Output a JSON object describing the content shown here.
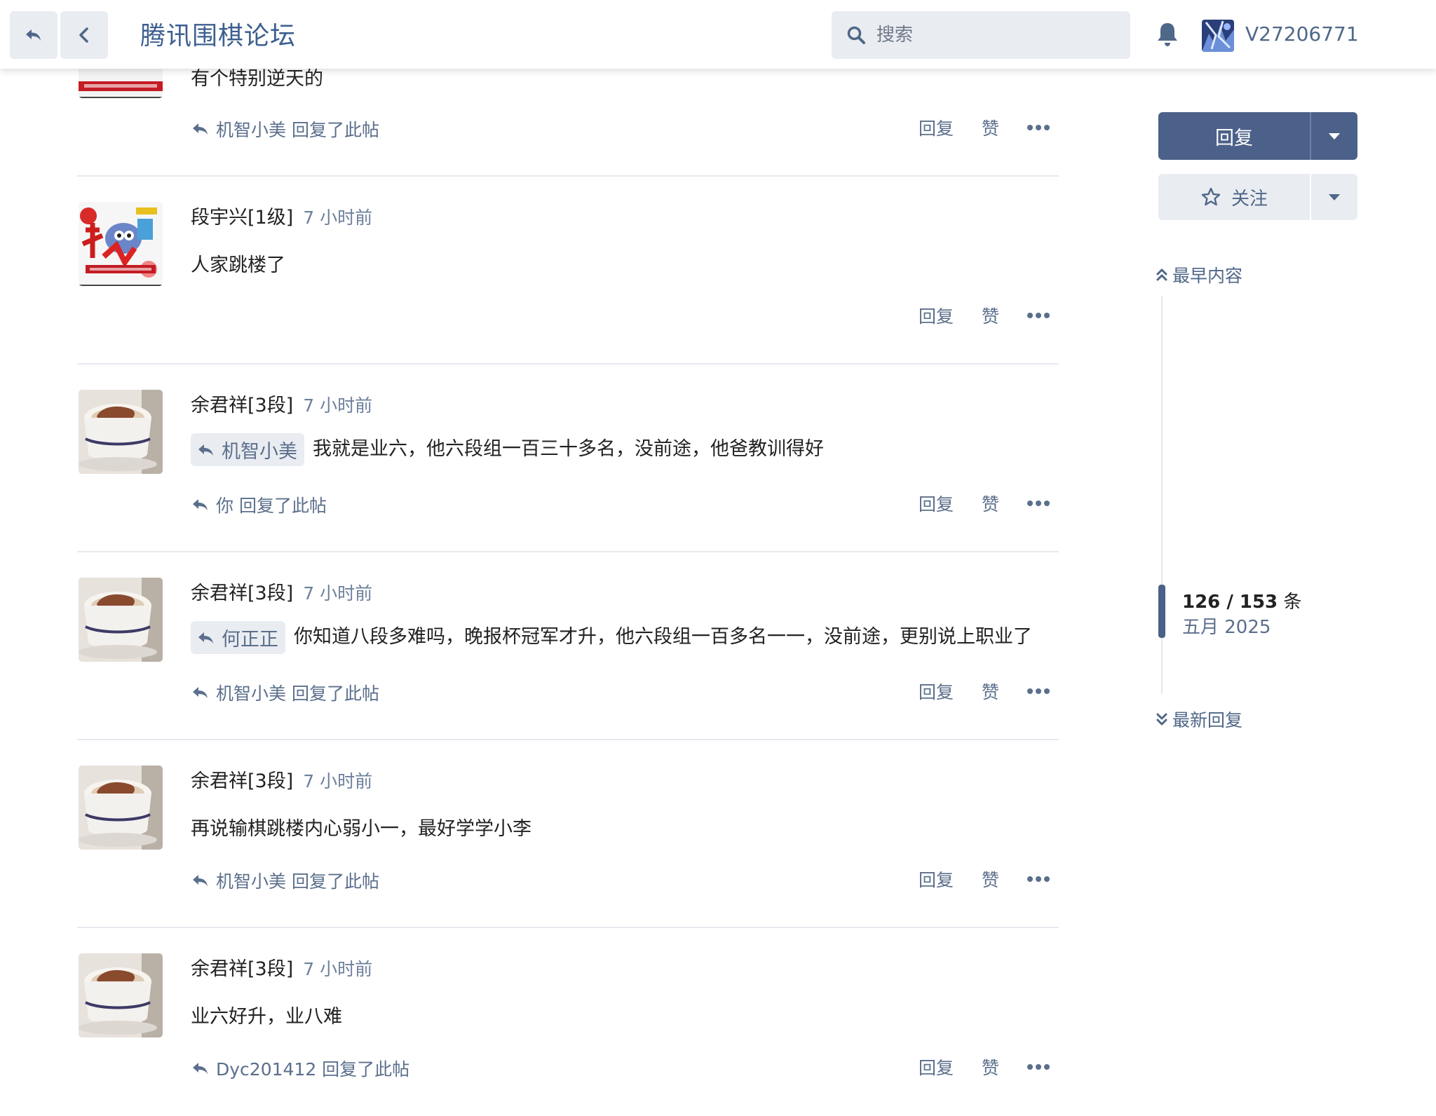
{
  "header": {
    "title": "腾讯围棋论坛",
    "search_placeholder": "搜索",
    "username": "V27206771"
  },
  "posts": [
    {
      "content": "有个特别逆天的",
      "reply_info": "机智小美 回复了此帖"
    },
    {
      "author": "段宇兴[1级]",
      "time": "7 小时前",
      "content": "人家跳楼了"
    },
    {
      "author": "余君祥[3段]",
      "time": "7 小时前",
      "quote": "机智小美",
      "content": "我就是业六，他六段组一百三十多名，没前途，他爸教训得好",
      "reply_info": "你 回复了此帖"
    },
    {
      "author": "余君祥[3段]",
      "time": "7 小时前",
      "quote": "何正正",
      "content": "你知道八段多难吗，晚报杯冠军才升，他六段组一百多名一一，没前途，更别说上职业了",
      "reply_info": "机智小美 回复了此帖"
    },
    {
      "author": "余君祥[3段]",
      "time": "7 小时前",
      "content": "再说输棋跳楼内心弱小一，最好学学小李",
      "reply_info": "机智小美 回复了此帖"
    },
    {
      "author": "余君祥[3段]",
      "time": "7 小时前",
      "content": "业六好升，业八难",
      "reply_info": "Dyc201412 回复了此帖"
    }
  ],
  "actions": {
    "reply": "回复",
    "like": "赞"
  },
  "sidebar": {
    "reply_button": "回复",
    "follow_button": "关注",
    "earliest": "最早内容",
    "latest": "最新回复",
    "position": "126 / 153",
    "position_unit": "条",
    "date": "五月 2025",
    "position_fraction": 0.82
  },
  "colors": {
    "accent": "#4b6189",
    "link": "#5b6f8c",
    "title": "#3d5f90"
  }
}
